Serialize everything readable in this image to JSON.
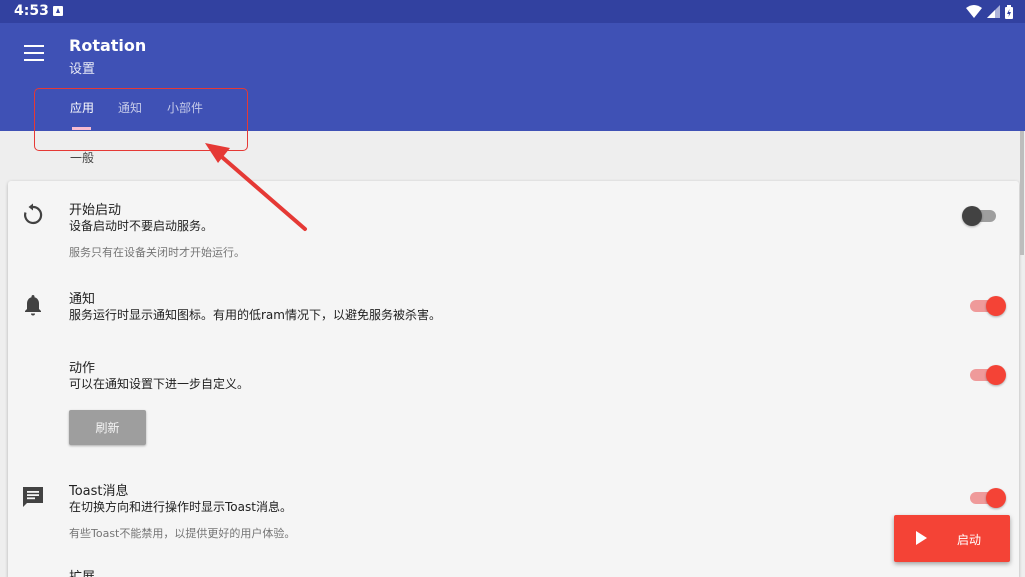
{
  "status_bar": {
    "time": "4:53"
  },
  "app_bar": {
    "title": "Rotation",
    "subtitle": "设置",
    "tabs": [
      {
        "label": "应用",
        "selected": true
      },
      {
        "label": "通知",
        "selected": false
      },
      {
        "label": "小部件",
        "selected": false
      }
    ]
  },
  "section": {
    "header": "一般"
  },
  "settings": {
    "start_on_boot": {
      "title": "开始启动",
      "summary": "设备启动时不要启动服务。",
      "note": "服务只有在设备关闭时才开始运行。",
      "enabled": false
    },
    "notification": {
      "title": "通知",
      "summary": "服务运行时显示通知图标。有用的低ram情况下，以避免服务被杀害。",
      "enabled": true
    },
    "actions": {
      "title": "动作",
      "summary": "可以在通知设置下进一步自定义。",
      "enabled": true,
      "refresh_label": "刷新"
    },
    "toast": {
      "title": "Toast消息",
      "summary": "在切换方向和进行操作时显示Toast消息。",
      "note": "有些Toast不能禁用，以提供更好的用户体验。",
      "enabled": true
    },
    "next": {
      "title": "扩展"
    }
  },
  "fab": {
    "label": "启动",
    "icon": "play-icon"
  },
  "colors": {
    "status_bar": "#3241a0",
    "app_bar": "#3f51b5",
    "accent": "#f44336",
    "annotation": "#e53935"
  }
}
